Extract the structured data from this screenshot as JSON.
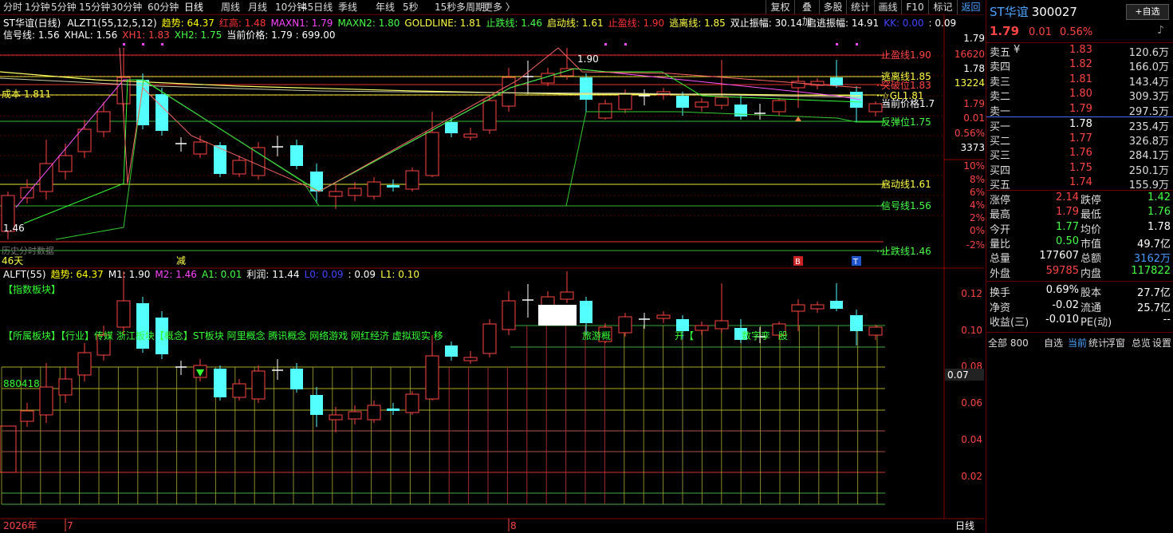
{
  "toolbar": {
    "periods": [
      "分时",
      "1分钟",
      "5分钟",
      "15分钟",
      "30分钟",
      "60分钟",
      "日线",
      "周线",
      "月线",
      "10分钟",
      "45日线",
      "季线",
      "年线",
      "5秒",
      "15秒",
      "多周期",
      "更多 〉"
    ],
    "active_period": "日线",
    "right_buttons": [
      "复权",
      "叠加",
      "多股",
      "统计",
      "画线",
      "F10",
      "标记",
      "返回"
    ]
  },
  "main_indicator": {
    "name": "ST华谊(日线)",
    "formula": "ALZT1(55,12,5,12)",
    "items_line1": [
      {
        "text": "趋势: 64.37",
        "color": "#ffff00"
      },
      {
        "text": "红高: 1.48",
        "color": "#ff3333"
      },
      {
        "text": "MAXN1: 1.79",
        "color": "#ff44ff"
      },
      {
        "text": "MAXN2: 1.80",
        "color": "#44ff44"
      },
      {
        "text": "GOLDLINE: 1.81",
        "color": "#ffff44"
      },
      {
        "text": "止跌线: 1.46",
        "color": "#44ff44"
      },
      {
        "text": "启动线: 1.61",
        "color": "#ffff44"
      },
      {
        "text": "止盈线: 1.90",
        "color": "#ff3333"
      },
      {
        "text": "逃离线: 1.85",
        "color": "#ffff44"
      },
      {
        "text": "双止振幅: 30.14",
        "color": "#ffffff"
      },
      {
        "text": "启逃振幅: 14.91",
        "color": "#ffffff"
      },
      {
        "text": "KK: 0.00",
        "color": "#4444ff"
      },
      {
        "text": ": 0.09",
        "color": "#ffffff"
      }
    ],
    "items_line2": [
      {
        "text": "信号线: 1.56",
        "color": "#ffffff"
      },
      {
        "text": "XHAL: 1.56",
        "color": "#ffffff"
      },
      {
        "text": "XH1: 1.83",
        "color": "#ff4444"
      },
      {
        "text": "XH2: 1.75",
        "color": "#44ff44"
      },
      {
        "text": "当前价格: 1.79 : 699.00",
        "color": "#ffffff"
      }
    ],
    "cost_label": "成本 1.811",
    "peak_label": "1.90",
    "low_label": "1.46",
    "days_label": "46天",
    "ghost_label": "历史分时数据",
    "reduce_label": "减",
    "b_label": "B",
    "t_label": "T"
  },
  "level_labels": [
    {
      "text": "止盈线1.90",
      "color": "#ff4444"
    },
    {
      "text": "逃离线1.85",
      "color": "#ffff44"
    },
    {
      "text": "突破位1.83",
      "color": "#ff4444"
    },
    {
      "text": "☆GL1.81",
      "color": "#ffff44"
    },
    {
      "text": "当前价格1.7",
      "color": "#ffffff"
    },
    {
      "text": "反弹位1.75",
      "color": "#44ff44"
    },
    {
      "text": "启动线1.61",
      "color": "#ffff44"
    },
    {
      "text": "信号线1.56",
      "color": "#44ff44"
    },
    {
      "text": "止跌线1.46",
      "color": "#44ff44"
    }
  ],
  "price_axis": [
    {
      "text": "1.79",
      "color": "#ffffff"
    },
    {
      "text": "16620",
      "color": "#ff4444"
    },
    {
      "text": "1.78",
      "color": "#ffffff"
    },
    {
      "text": "13224",
      "color": "#ffff44"
    },
    {
      "text": "1.79",
      "color": "#ff4444"
    },
    {
      "text": "0.01",
      "color": "#ff4444"
    },
    {
      "text": "0.56%",
      "color": "#ff4444"
    },
    {
      "text": "3373",
      "color": "#ffffff"
    },
    {
      "text": "10%",
      "color": "#ff4444"
    },
    {
      "text": "8%",
      "color": "#ff4444"
    },
    {
      "text": "6%",
      "color": "#ff4444"
    },
    {
      "text": "4%",
      "color": "#ff4444"
    },
    {
      "text": "2%",
      "color": "#ff4444"
    },
    {
      "text": "0%",
      "color": "#ff4444"
    },
    {
      "text": "-2%",
      "color": "#ff4444"
    }
  ],
  "sub_indicator": {
    "name": "ALFT(55)",
    "items": [
      {
        "text": "趋势: 64.37",
        "color": "#ffff00"
      },
      {
        "text": "M1: 1.90",
        "color": "#ffffff"
      },
      {
        "text": "M2: 1.46",
        "color": "#ff44ff"
      },
      {
        "text": "A1: 0.01",
        "color": "#44ff44"
      },
      {
        "text": "利润: 11.44",
        "color": "#ffffff"
      },
      {
        "text": "L0: 0.09",
        "color": "#4444ff"
      },
      {
        "text": ": 0.09",
        "color": "#ffffff"
      },
      {
        "text": "L1: 0.10",
        "color": "#ffff44"
      }
    ],
    "block_tag": "【指数板块】",
    "concept_text": "【所属板块】【行业】传媒    浙江板块【概念】ST板块 阿里概念 腾讯概念 网络游戏 网红经济 虚拟现实 移",
    "concept_tail": "旅游概",
    "concept_tail2": "开【",
    "concept_tail3": "数字孪",
    "concept_tail4": "股",
    "vol_label": "880418",
    "axis": [
      "0.12",
      "0.10",
      "0.08",
      "0.06",
      "0.04",
      "0.02"
    ],
    "current": "0.07"
  },
  "bottom_axis": {
    "year": "2026年",
    "m1": "7",
    "m2": "8",
    "period": "日线"
  },
  "right_panel": {
    "name": "ST华谊",
    "code": "300027",
    "select_btn": "+自选",
    "price": "1.79",
    "change": "0.01",
    "pct": "0.56%",
    "asks": [
      {
        "label": "卖五",
        "price": "1.83",
        "vol": "120.6万",
        "mark": "¥"
      },
      {
        "label": "卖四",
        "price": "1.82",
        "vol": "166.0万",
        "mark": ""
      },
      {
        "label": "卖三",
        "price": "1.81",
        "vol": "143.4万",
        "mark": ""
      },
      {
        "label": "卖二",
        "price": "1.80",
        "vol": "309.3万",
        "mark": ""
      },
      {
        "label": "卖一",
        "price": "1.79",
        "vol": "297.5万",
        "mark": ""
      }
    ],
    "bids": [
      {
        "label": "买一",
        "price": "1.78",
        "vol": "235.4万",
        "pcolor": "#ffffff"
      },
      {
        "label": "买二",
        "price": "1.77",
        "vol": "326.8万",
        "pcolor": "#ff4444"
      },
      {
        "label": "买三",
        "price": "1.76",
        "vol": "284.1万",
        "pcolor": "#ff4444"
      },
      {
        "label": "买四",
        "price": "1.75",
        "vol": "250.1万",
        "pcolor": "#ff4444"
      },
      {
        "label": "买五",
        "price": "1.74",
        "vol": "155.9万",
        "pcolor": "#ff4444"
      }
    ],
    "stats": [
      {
        "l1": "涨停",
        "v1": "2.14",
        "c1": "#ff4444",
        "l2": "跌停",
        "v2": "1.42",
        "c2": "#44ff44"
      },
      {
        "l1": "最高",
        "v1": "1.79",
        "c1": "#ff4444",
        "l2": "最低",
        "v2": "1.76",
        "c2": "#44ff44"
      },
      {
        "l1": "今开",
        "v1": "1.77",
        "c1": "#44ff44",
        "l2": "均价",
        "v2": "1.78",
        "c2": "#ffffff"
      },
      {
        "l1": "量比",
        "v1": "0.50",
        "c1": "#44ff44",
        "l2": "市值",
        "v2": "49.7亿",
        "c2": "#ffffff"
      },
      {
        "l1": "总量",
        "v1": "177607",
        "c1": "#ffffff",
        "l2": "总额",
        "v2": "3162万",
        "c2": "#4499ff"
      },
      {
        "l1": "外盘",
        "v1": "59785",
        "c1": "#ff4444",
        "l2": "内盘",
        "v2": "117822",
        "c2": "#44ff44"
      }
    ],
    "stats2": [
      {
        "l1": "换手",
        "v1": "0.69%",
        "c1": "#ffffff",
        "l2": "股本",
        "v2": "27.7亿",
        "c2": "#ffffff"
      },
      {
        "l1": "净资",
        "v1": "-0.02",
        "c1": "#ffffff",
        "l2": "流通",
        "v2": "25.7亿",
        "c2": "#ffffff"
      },
      {
        "l1": "收益(三)",
        "v1": "-0.010",
        "c1": "#ffffff",
        "l2": "PE(动)",
        "v2": "--",
        "c2": "#ffffff"
      }
    ],
    "footer": [
      "全部 800",
      "自选",
      "当前",
      "统计",
      "浮窗",
      "总览",
      "设置"
    ]
  }
}
